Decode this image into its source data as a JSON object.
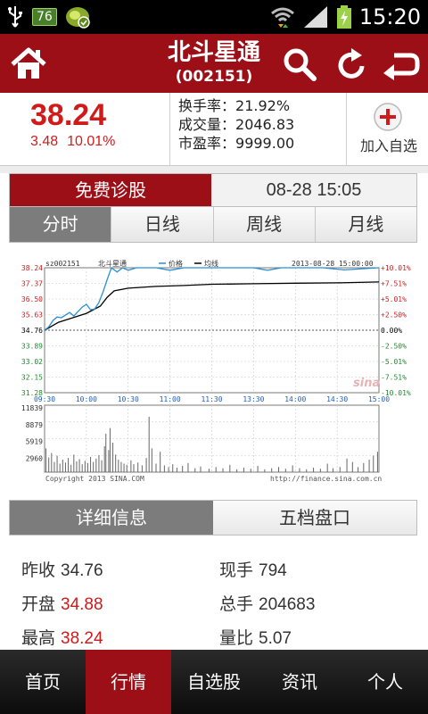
{
  "status_bar": {
    "battery_badge": "76",
    "time": "15:20",
    "icons": [
      "usb-icon",
      "battery-badge",
      "app-notify-icon",
      "wifi-icon",
      "signal-icon",
      "battery-charging-icon"
    ]
  },
  "header": {
    "title": "北斗星通",
    "code": "(002151)",
    "icons": [
      "home-icon",
      "search-icon",
      "refresh-icon",
      "back-icon"
    ]
  },
  "quote": {
    "price": "38.24",
    "change": "3.48",
    "change_pct": "10.01%",
    "turnover_label": "换手率：",
    "turnover": "21.92%",
    "volume_label": "成交量：",
    "volume": "2046.83",
    "pe_label": "市盈率：",
    "pe": "9999.00",
    "add_watch": "加入自选"
  },
  "diagnose": {
    "button": "免费诊股",
    "datetime": "08-28 15:05"
  },
  "tabs": [
    {
      "label": "分时",
      "active": true
    },
    {
      "label": "日线",
      "active": false
    },
    {
      "label": "周线",
      "active": false
    },
    {
      "label": "月线",
      "active": false
    }
  ],
  "chart_data": {
    "type": "line",
    "symbol_label": "sz002151",
    "name_label": "北斗星通",
    "legend": [
      {
        "name": "价格",
        "color": "#2a8fd6"
      },
      {
        "name": "均线",
        "color": "#000000"
      }
    ],
    "date_label": "2013-08-28 15:00:00",
    "y_ticks_left": [
      "38.24",
      "37.37",
      "36.50",
      "35.63",
      "34.76",
      "33.89",
      "33.02",
      "32.15",
      "31.28"
    ],
    "y_ticks_right": [
      "+10.01%",
      "+7.51%",
      "+5.01%",
      "+2.50%",
      "0.00%",
      "-2.50%",
      "-5.01%",
      "-7.51%",
      "-10.01%"
    ],
    "x_ticks": [
      "09:30",
      "10:00",
      "10:30",
      "11:00",
      "11:30",
      "13:30",
      "14:00",
      "14:30",
      "15:00"
    ],
    "ylim": [
      31.28,
      38.24
    ],
    "prev_close": 34.76,
    "price_series": [
      [
        0,
        34.76
      ],
      [
        3,
        34.95
      ],
      [
        6,
        35.3
      ],
      [
        9,
        35.5
      ],
      [
        12,
        35.45
      ],
      [
        15,
        35.6
      ],
      [
        18,
        35.75
      ],
      [
        21,
        35.55
      ],
      [
        24,
        35.8
      ],
      [
        27,
        36.05
      ],
      [
        30,
        36.2
      ],
      [
        33,
        35.9
      ],
      [
        36,
        35.95
      ],
      [
        39,
        36.3
      ],
      [
        42,
        36.9
      ],
      [
        45,
        37.6
      ],
      [
        48,
        38.24
      ],
      [
        52,
        38.0
      ],
      [
        56,
        38.24
      ],
      [
        60,
        38.1
      ],
      [
        66,
        38.24
      ],
      [
        80,
        38.24
      ],
      [
        90,
        38.1
      ],
      [
        100,
        38.24
      ],
      [
        120,
        38.24
      ],
      [
        150,
        38.24
      ],
      [
        160,
        38.1
      ],
      [
        170,
        38.24
      ],
      [
        200,
        38.24
      ],
      [
        215,
        38.12
      ],
      [
        240,
        38.24
      ]
    ],
    "avg_series": [
      [
        0,
        34.76
      ],
      [
        10,
        35.2
      ],
      [
        20,
        35.45
      ],
      [
        30,
        35.7
      ],
      [
        40,
        36.1
      ],
      [
        45,
        36.6
      ],
      [
        50,
        36.95
      ],
      [
        60,
        37.1
      ],
      [
        80,
        37.2
      ],
      [
        100,
        37.25
      ],
      [
        120,
        37.32
      ],
      [
        150,
        37.35
      ],
      [
        180,
        37.38
      ],
      [
        210,
        37.4
      ],
      [
        240,
        37.45
      ]
    ],
    "volume_ticks": [
      "11839",
      "8879",
      "5919",
      "2960"
    ],
    "volume_max": 11839,
    "volume_bars": [
      [
        1,
        4200
      ],
      [
        3,
        2600
      ],
      [
        5,
        3400
      ],
      [
        7,
        1800
      ],
      [
        9,
        2900
      ],
      [
        11,
        1500
      ],
      [
        13,
        2200
      ],
      [
        15,
        1700
      ],
      [
        17,
        2500
      ],
      [
        19,
        1300
      ],
      [
        21,
        3100
      ],
      [
        23,
        1900
      ],
      [
        25,
        2300
      ],
      [
        27,
        1400
      ],
      [
        29,
        2000
      ],
      [
        31,
        1600
      ],
      [
        33,
        2700
      ],
      [
        35,
        1800
      ],
      [
        37,
        2400
      ],
      [
        39,
        3000
      ],
      [
        41,
        2100
      ],
      [
        43,
        4600
      ],
      [
        44,
        6800
      ],
      [
        46,
        3900
      ],
      [
        47,
        7800
      ],
      [
        49,
        5200
      ],
      [
        51,
        3100
      ],
      [
        53,
        2200
      ],
      [
        55,
        1800
      ],
      [
        57,
        1500
      ],
      [
        59,
        1300
      ],
      [
        62,
        2100
      ],
      [
        64,
        1400
      ],
      [
        67,
        1700
      ],
      [
        70,
        1200
      ],
      [
        73,
        2500
      ],
      [
        75,
        9800
      ],
      [
        77,
        4200
      ],
      [
        80,
        1500
      ],
      [
        83,
        3600
      ],
      [
        86,
        1200
      ],
      [
        89,
        900
      ],
      [
        92,
        1400
      ],
      [
        95,
        800
      ],
      [
        99,
        1100
      ],
      [
        103,
        1600
      ],
      [
        108,
        700
      ],
      [
        112,
        1000
      ],
      [
        118,
        600
      ],
      [
        123,
        900
      ],
      [
        128,
        700
      ],
      [
        133,
        1300
      ],
      [
        138,
        500
      ],
      [
        143,
        800
      ],
      [
        148,
        600
      ],
      [
        153,
        1100
      ],
      [
        158,
        500
      ],
      [
        163,
        700
      ],
      [
        168,
        900
      ],
      [
        173,
        600
      ],
      [
        178,
        1200
      ],
      [
        183,
        700
      ],
      [
        188,
        500
      ],
      [
        193,
        800
      ],
      [
        198,
        600
      ],
      [
        203,
        1500
      ],
      [
        207,
        700
      ],
      [
        212,
        900
      ],
      [
        217,
        2400
      ],
      [
        221,
        1800
      ],
      [
        225,
        900
      ],
      [
        229,
        1600
      ],
      [
        233,
        2200
      ],
      [
        236,
        2900
      ],
      [
        239,
        3600
      ]
    ],
    "copyright": "Copyright 2013 SINA.COM",
    "source_url": "http://finance.sina.com.cn",
    "watermark": "sina"
  },
  "detail_tabs": [
    {
      "label": "详细信息",
      "active": true
    },
    {
      "label": "五档盘口",
      "active": false
    }
  ],
  "details": {
    "prev_close_label": "昨收",
    "prev_close": "34.76",
    "current_hand_label": "现手",
    "current_hand": "794",
    "open_label": "开盘",
    "open": "34.88",
    "total_hand_label": "总手",
    "total_hand": "204683",
    "high_label": "最高",
    "high": "38.24",
    "vol_ratio_label": "量比",
    "vol_ratio": "5.07"
  },
  "bottom_nav": [
    {
      "label": "首页",
      "active": false
    },
    {
      "label": "行情",
      "active": true
    },
    {
      "label": "自选股",
      "active": false
    },
    {
      "label": "资讯",
      "active": false
    },
    {
      "label": "个人",
      "active": false
    }
  ],
  "colors": {
    "brand_red": "#9c0f17",
    "up_red": "#d11a1a",
    "price_line": "#2a8fd6",
    "avg_line": "#000000"
  }
}
